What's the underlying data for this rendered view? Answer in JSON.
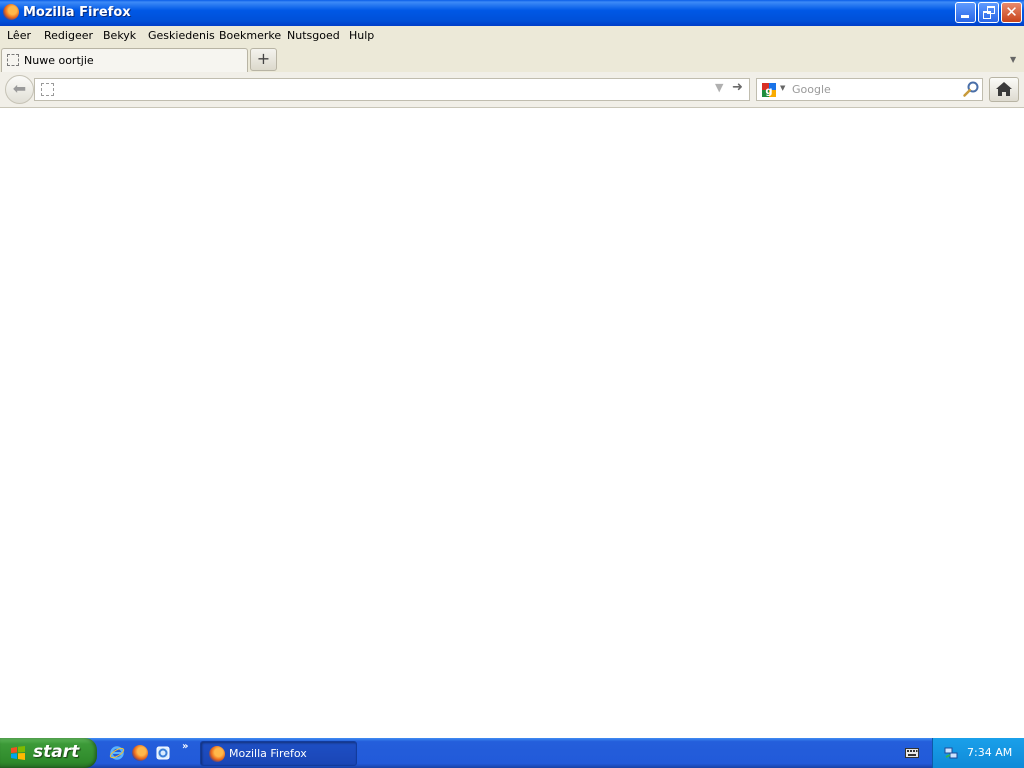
{
  "window": {
    "title": "Mozilla Firefox"
  },
  "menu": {
    "items": [
      "Lêer",
      "Redigeer",
      "Bekyk",
      "Geskiedenis",
      "Boekmerke",
      "Nutsgoed",
      "Hulp"
    ]
  },
  "tabs": [
    {
      "label": "Nuwe oortjie",
      "active": true
    }
  ],
  "toolbar": {
    "url_value": "",
    "search_engine_icon": "google-icon",
    "search_placeholder": "Google",
    "search_value": ""
  },
  "taskbar": {
    "start_label": "start",
    "quick_launch": [
      "internet-explorer-icon",
      "firefox-icon",
      "show-desktop-icon"
    ],
    "task_buttons": [
      {
        "label": "Mozilla Firefox",
        "icon": "firefox-icon"
      }
    ],
    "clock": "7:34 AM"
  },
  "colors": {
    "titlebar": "#0058e6",
    "menubar": "#ece9d8",
    "taskbar": "#245edb",
    "start_button": "#3c9a38",
    "tray": "#0f8ad8"
  }
}
